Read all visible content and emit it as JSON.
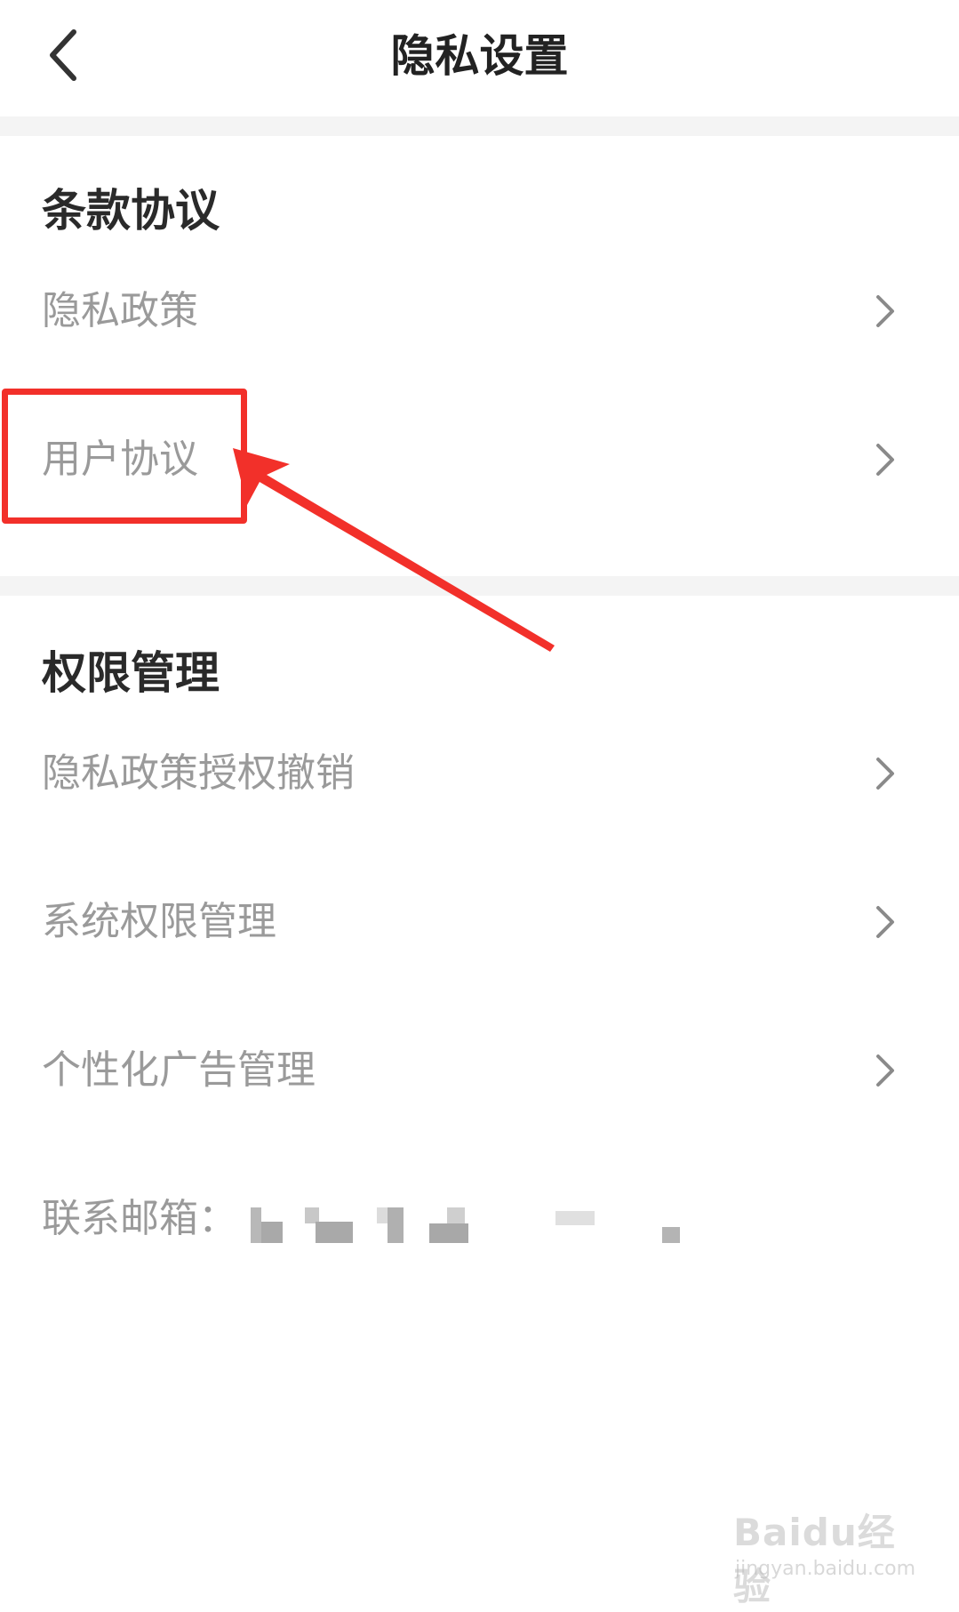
{
  "header": {
    "title": "隐私设置"
  },
  "sections": [
    {
      "title": "条款协议",
      "items": [
        "隐私政策",
        "用户协议"
      ]
    },
    {
      "title": "权限管理",
      "items": [
        "隐私政策授权撤销",
        "系统权限管理",
        "个性化广告管理"
      ]
    }
  ],
  "contact": {
    "label": "联系邮箱："
  },
  "icons": {
    "back": "back-arrow-icon",
    "row": "chevron-right-icon"
  },
  "colors": {
    "annotation": "#f2302a",
    "title_text": "#222222",
    "item_text": "#9a9a9a",
    "divider": "#f4f4f4"
  },
  "watermark": {
    "main": "Baidu经验",
    "sub": "jingyan.baidu.com"
  }
}
